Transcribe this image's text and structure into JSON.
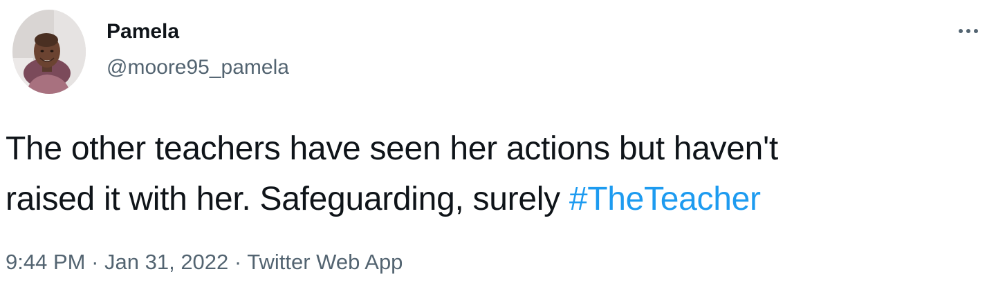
{
  "author": {
    "display_name": "Pamela",
    "handle": "@moore95_pamela",
    "avatar_icon": "profile-photo"
  },
  "more_icon": "more-horizontal-icon",
  "tweet": {
    "text_lines": [
      "The other teachers have seen her actions but haven't",
      "raised it with her. Safeguarding, surely "
    ],
    "hashtag": "#TheTeacher"
  },
  "meta": {
    "time": "9:44 PM",
    "separator": " · ",
    "date": "Jan 31, 2022",
    "source": "Twitter Web App"
  },
  "colors": {
    "text": "#0f1419",
    "secondary": "#536471",
    "link": "#1d9bf0",
    "background": "#ffffff"
  }
}
